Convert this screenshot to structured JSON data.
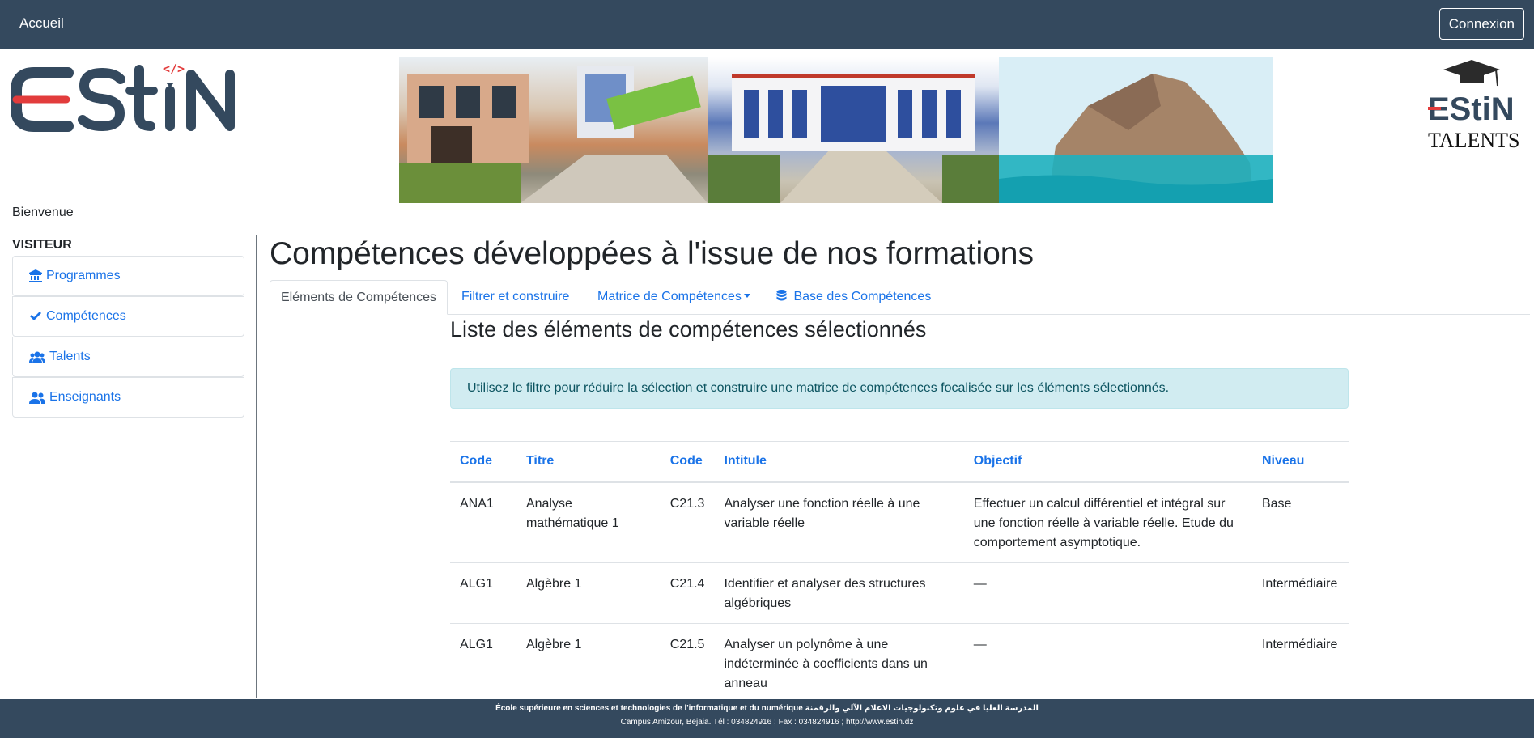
{
  "nav": {
    "home_label": "Accueil",
    "login_label": "Connexion"
  },
  "logo": {
    "estin_text": "EStiN",
    "talents_text": "TALENTS",
    "talents_estin": "EStiN"
  },
  "sidebar": {
    "welcome": "Bienvenue",
    "section_title": "VISITEUR",
    "items": [
      {
        "label": "Programmes",
        "icon": "university-icon"
      },
      {
        "label": "Compétences",
        "icon": "check-icon"
      },
      {
        "label": "Talents",
        "icon": "users-icon"
      },
      {
        "label": "Enseignants",
        "icon": "user-friends-icon"
      }
    ]
  },
  "main": {
    "title": "Compétences développées à l'issue de nos formations",
    "tabs": [
      {
        "label": "Eléments de Compétences"
      },
      {
        "label": "Filtrer et construire"
      },
      {
        "label": "Matrice de Compétences"
      },
      {
        "label": "Base des Compétences"
      }
    ],
    "section_title": "Liste des éléments de compétences sélectionnés",
    "alert": "Utilisez le filtre pour réduire la sélection et construire une matrice de compétences focalisée sur les éléments sélectionnés.",
    "table": {
      "headers": [
        "Code",
        "Titre",
        "Code",
        "Intitule",
        "Objectif",
        "Niveau"
      ],
      "rows": [
        [
          "ANA1",
          "Analyse mathématique 1",
          "C21.3",
          "Analyser une fonction réelle à une variable réelle",
          "Effectuer un calcul différentiel et intégral sur une fonction réelle à variable réelle. Etude du comportement asymptotique.",
          "Base"
        ],
        [
          "ALG1",
          "Algèbre 1",
          "C21.4",
          "Identifier et analyser des structures algébriques",
          "—",
          "Intermédiaire"
        ],
        [
          "ALG1",
          "Algèbre 1",
          "C21.5",
          "Analyser un polynôme à une indéterminée à coefficients dans un anneau",
          "—",
          "Intermédiaire"
        ]
      ]
    }
  },
  "footer": {
    "line1": "École supérieure en sciences et technologies de l'informatique et du numérique المدرسة العليا في علوم وتكنولوجيات الاعلام الآلي والرقمنة",
    "line2": "Campus Amizour, Bejaia. Tél : 034824916 ; Fax : 034824916 ; http://www.estin.dz"
  },
  "colors": {
    "navbar": "#34495e",
    "link": "#1a73e8",
    "alert_bg": "#d1ecf1",
    "estin_red": "#e23c3c",
    "estin_dark": "#34495e"
  }
}
